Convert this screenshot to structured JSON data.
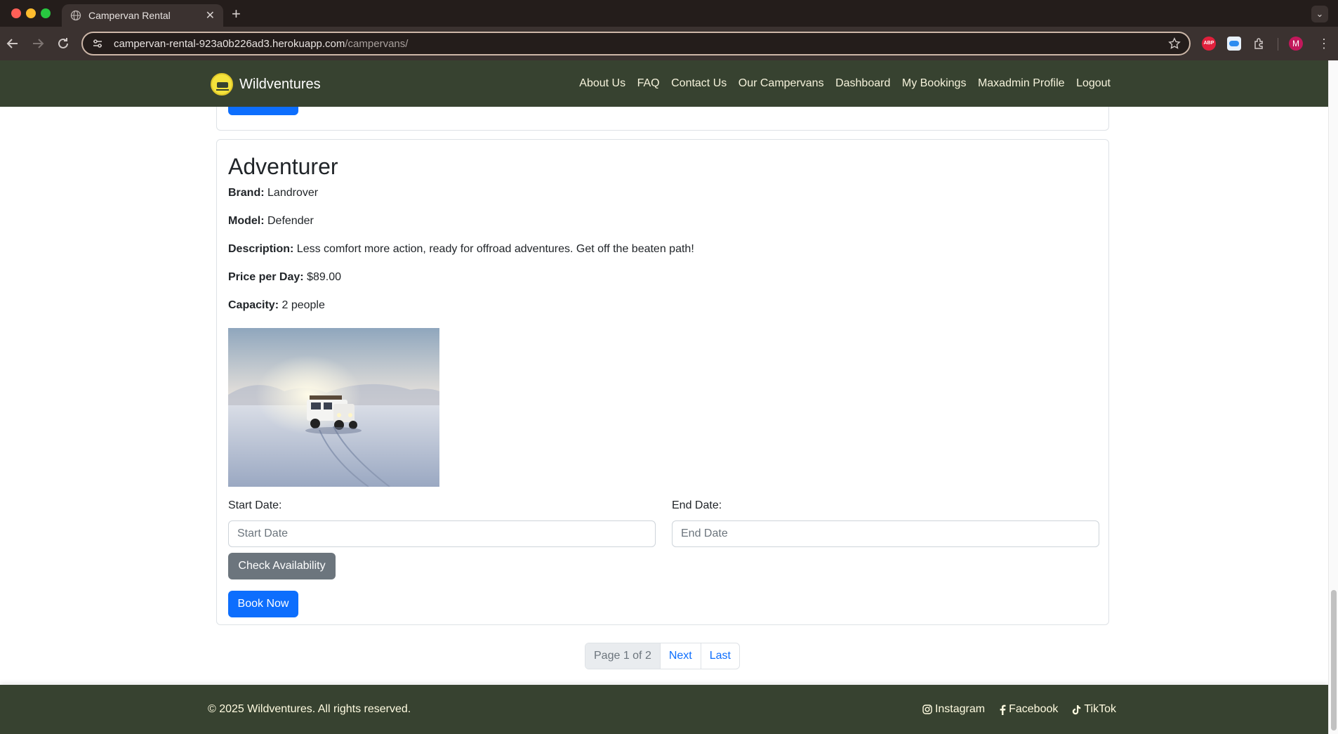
{
  "browser": {
    "tab_title": "Campervan Rental",
    "url_host": "campervan-rental-923a0b226ad3.herokuapp.com",
    "url_path": "/campervans/",
    "profile_initial": "M",
    "abp_label": "ABP"
  },
  "site": {
    "brand": "Wildventures",
    "nav": [
      "About Us",
      "FAQ",
      "Contact Us",
      "Our Campervans",
      "Dashboard",
      "My Bookings",
      "Maxadmin Profile",
      "Logout"
    ]
  },
  "campervan": {
    "name": "Adventurer",
    "brand_label": "Brand:",
    "brand": "Landrover",
    "model_label": "Model:",
    "model": "Defender",
    "description_label": "Description:",
    "description": "Less comfort more action, ready for offroad adventures. Get off the beaten path!",
    "price_label": "Price per Day:",
    "price": "$89.00",
    "capacity_label": "Capacity:",
    "capacity": "2 people"
  },
  "booking": {
    "start_label": "Start Date:",
    "start_placeholder": "Start Date",
    "end_label": "End Date:",
    "end_placeholder": "End Date",
    "check_button": "Check Availability",
    "book_button": "Book Now"
  },
  "pagination": {
    "current": "Page 1 of 2",
    "next": "Next",
    "last": "Last"
  },
  "footer": {
    "copyright": "© 2025 Wildventures. All rights reserved.",
    "social": [
      "Instagram",
      "Facebook",
      "TikTok"
    ]
  }
}
